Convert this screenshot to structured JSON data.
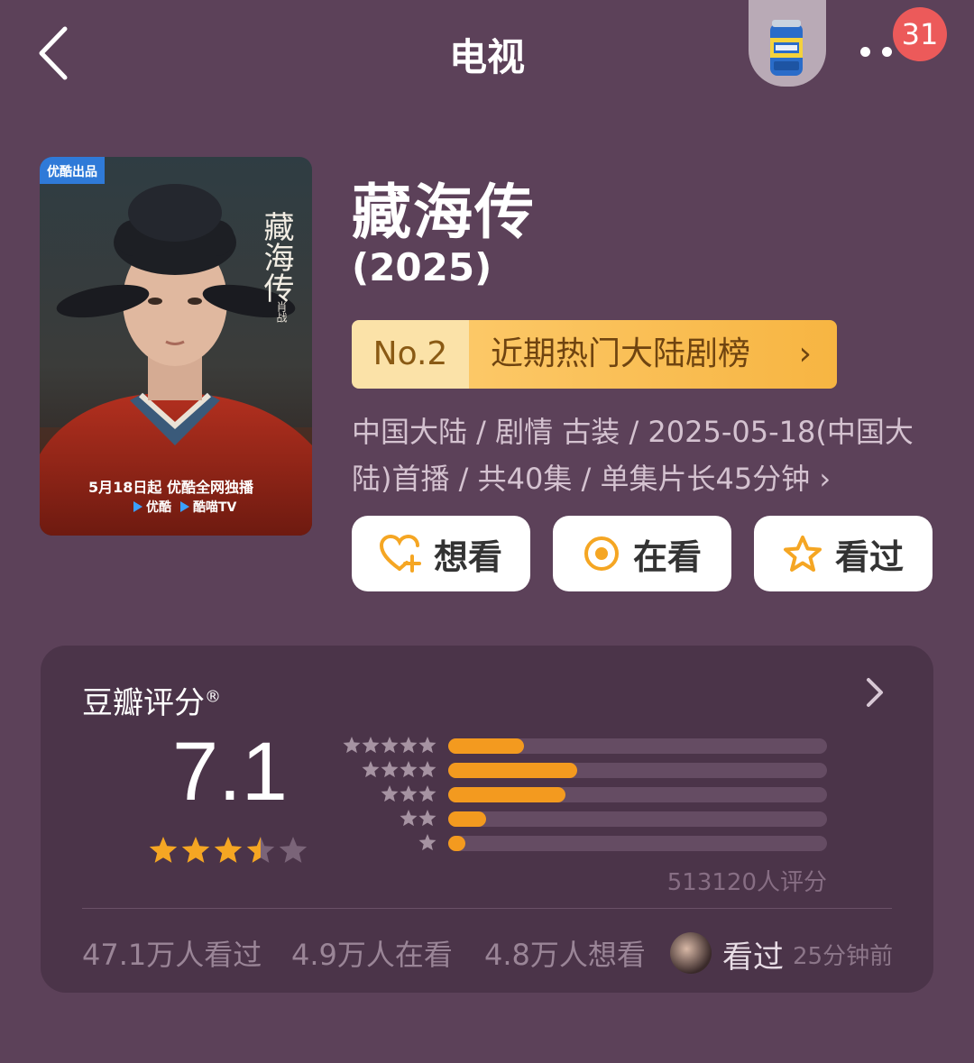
{
  "header": {
    "title": "电视",
    "badge_count": "31"
  },
  "poster": {
    "producer_tag": "优酷出品",
    "title_vertical": "藏海传",
    "tagline": "5月18日起 优酷全网独播",
    "platform_1": "优酷",
    "platform_2": "酷喵TV",
    "actor": "肖战"
  },
  "show": {
    "title": "藏海传",
    "year": "(2025)",
    "rank_no": "No.2",
    "rank_name": "近期热门大陆剧榜",
    "meta_line1": "中国大陆 / 剧情 古装 / 2025-05-18(中国大",
    "meta_line2": "陆)首播 / 共40集 / 单集片长45分钟 ›"
  },
  "actions": {
    "want": "想看",
    "watching": "在看",
    "watched": "看过"
  },
  "rating": {
    "header": "豆瓣评分",
    "reg_mark": "®",
    "score": "7.1",
    "score_stars": 3.5,
    "count_text": "513120人评分",
    "distribution": [
      {
        "stars": 5,
        "share": 0.2
      },
      {
        "stars": 4,
        "share": 0.34
      },
      {
        "stars": 3,
        "share": 0.31
      },
      {
        "stars": 2,
        "share": 0.1
      },
      {
        "stars": 1,
        "share": 0.045
      }
    ]
  },
  "stats": {
    "watched": "47.1万人看过",
    "watching": "4.9万人在看",
    "want": "4.8万人想看",
    "friend_action": "看过",
    "friend_time": "25分钟前"
  },
  "colors": {
    "background": "#5c4159",
    "card": "#4b3449",
    "accent_orange": "#f39a1f",
    "rank_gold": "#f7b542",
    "badge_red": "#ec5a5a"
  }
}
